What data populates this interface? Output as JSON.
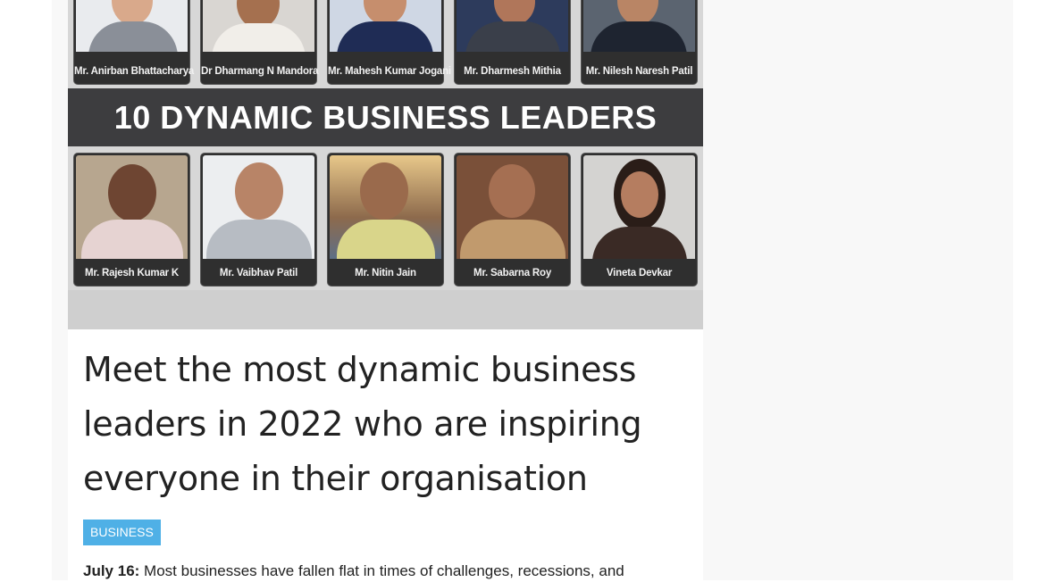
{
  "banner": {
    "heading": "10 DYNAMIC BUSINESS LEADERS",
    "top_row": [
      {
        "name": "Mr. Anirban Bhattacharya"
      },
      {
        "name": "Dr Dharmang N Mandora"
      },
      {
        "name": "Mr. Mahesh Kumar Jogani"
      },
      {
        "name": "Mr. Dharmesh Mithia"
      },
      {
        "name": "Mr. Nilesh Naresh Patil"
      }
    ],
    "bottom_row": [
      {
        "name": "Mr. Rajesh Kumar K"
      },
      {
        "name": "Mr. Vaibhav Patil"
      },
      {
        "name": "Mr. Nitin Jain"
      },
      {
        "name": "Mr. Sabarna Roy"
      },
      {
        "name": "Vineta Devkar"
      }
    ]
  },
  "article": {
    "title": "Meet the most dynamic business leaders in 2022 who are inspiring everyone in their organisation",
    "category": "BUSINESS",
    "dateline": "July 16:",
    "lede": "Most businesses have fallen flat in times of challenges, recessions, and"
  },
  "colors": {
    "category_bg": "#4fb0e6",
    "title_band": "#3d3d3f",
    "headline_text": "#222222"
  }
}
